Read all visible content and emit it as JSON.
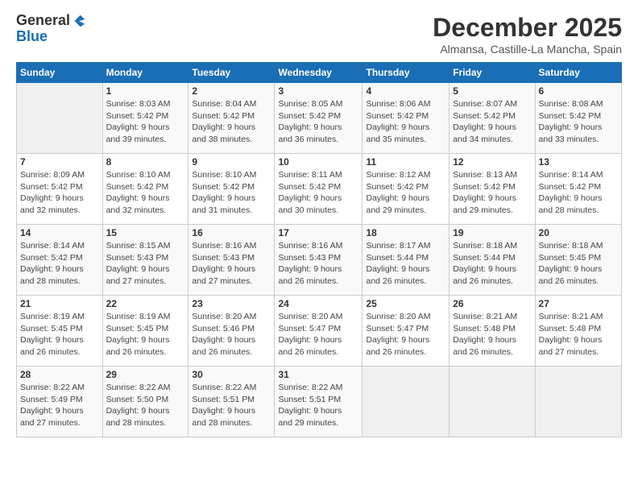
{
  "logo": {
    "line1": "General",
    "line2": "Blue"
  },
  "title": "December 2025",
  "subtitle": "Almansa, Castille-La Mancha, Spain",
  "headers": [
    "Sunday",
    "Monday",
    "Tuesday",
    "Wednesday",
    "Thursday",
    "Friday",
    "Saturday"
  ],
  "weeks": [
    [
      {
        "day": "",
        "info": ""
      },
      {
        "day": "1",
        "info": "Sunrise: 8:03 AM\nSunset: 5:42 PM\nDaylight: 9 hours\nand 39 minutes."
      },
      {
        "day": "2",
        "info": "Sunrise: 8:04 AM\nSunset: 5:42 PM\nDaylight: 9 hours\nand 38 minutes."
      },
      {
        "day": "3",
        "info": "Sunrise: 8:05 AM\nSunset: 5:42 PM\nDaylight: 9 hours\nand 36 minutes."
      },
      {
        "day": "4",
        "info": "Sunrise: 8:06 AM\nSunset: 5:42 PM\nDaylight: 9 hours\nand 35 minutes."
      },
      {
        "day": "5",
        "info": "Sunrise: 8:07 AM\nSunset: 5:42 PM\nDaylight: 9 hours\nand 34 minutes."
      },
      {
        "day": "6",
        "info": "Sunrise: 8:08 AM\nSunset: 5:42 PM\nDaylight: 9 hours\nand 33 minutes."
      }
    ],
    [
      {
        "day": "7",
        "info": "Sunrise: 8:09 AM\nSunset: 5:42 PM\nDaylight: 9 hours\nand 32 minutes."
      },
      {
        "day": "8",
        "info": "Sunrise: 8:10 AM\nSunset: 5:42 PM\nDaylight: 9 hours\nand 32 minutes."
      },
      {
        "day": "9",
        "info": "Sunrise: 8:10 AM\nSunset: 5:42 PM\nDaylight: 9 hours\nand 31 minutes."
      },
      {
        "day": "10",
        "info": "Sunrise: 8:11 AM\nSunset: 5:42 PM\nDaylight: 9 hours\nand 30 minutes."
      },
      {
        "day": "11",
        "info": "Sunrise: 8:12 AM\nSunset: 5:42 PM\nDaylight: 9 hours\nand 29 minutes."
      },
      {
        "day": "12",
        "info": "Sunrise: 8:13 AM\nSunset: 5:42 PM\nDaylight: 9 hours\nand 29 minutes."
      },
      {
        "day": "13",
        "info": "Sunrise: 8:14 AM\nSunset: 5:42 PM\nDaylight: 9 hours\nand 28 minutes."
      }
    ],
    [
      {
        "day": "14",
        "info": "Sunrise: 8:14 AM\nSunset: 5:42 PM\nDaylight: 9 hours\nand 28 minutes."
      },
      {
        "day": "15",
        "info": "Sunrise: 8:15 AM\nSunset: 5:43 PM\nDaylight: 9 hours\nand 27 minutes."
      },
      {
        "day": "16",
        "info": "Sunrise: 8:16 AM\nSunset: 5:43 PM\nDaylight: 9 hours\nand 27 minutes."
      },
      {
        "day": "17",
        "info": "Sunrise: 8:16 AM\nSunset: 5:43 PM\nDaylight: 9 hours\nand 26 minutes."
      },
      {
        "day": "18",
        "info": "Sunrise: 8:17 AM\nSunset: 5:44 PM\nDaylight: 9 hours\nand 26 minutes."
      },
      {
        "day": "19",
        "info": "Sunrise: 8:18 AM\nSunset: 5:44 PM\nDaylight: 9 hours\nand 26 minutes."
      },
      {
        "day": "20",
        "info": "Sunrise: 8:18 AM\nSunset: 5:45 PM\nDaylight: 9 hours\nand 26 minutes."
      }
    ],
    [
      {
        "day": "21",
        "info": "Sunrise: 8:19 AM\nSunset: 5:45 PM\nDaylight: 9 hours\nand 26 minutes."
      },
      {
        "day": "22",
        "info": "Sunrise: 8:19 AM\nSunset: 5:45 PM\nDaylight: 9 hours\nand 26 minutes."
      },
      {
        "day": "23",
        "info": "Sunrise: 8:20 AM\nSunset: 5:46 PM\nDaylight: 9 hours\nand 26 minutes."
      },
      {
        "day": "24",
        "info": "Sunrise: 8:20 AM\nSunset: 5:47 PM\nDaylight: 9 hours\nand 26 minutes."
      },
      {
        "day": "25",
        "info": "Sunrise: 8:20 AM\nSunset: 5:47 PM\nDaylight: 9 hours\nand 26 minutes."
      },
      {
        "day": "26",
        "info": "Sunrise: 8:21 AM\nSunset: 5:48 PM\nDaylight: 9 hours\nand 26 minutes."
      },
      {
        "day": "27",
        "info": "Sunrise: 8:21 AM\nSunset: 5:48 PM\nDaylight: 9 hours\nand 27 minutes."
      }
    ],
    [
      {
        "day": "28",
        "info": "Sunrise: 8:22 AM\nSunset: 5:49 PM\nDaylight: 9 hours\nand 27 minutes."
      },
      {
        "day": "29",
        "info": "Sunrise: 8:22 AM\nSunset: 5:50 PM\nDaylight: 9 hours\nand 28 minutes."
      },
      {
        "day": "30",
        "info": "Sunrise: 8:22 AM\nSunset: 5:51 PM\nDaylight: 9 hours\nand 28 minutes."
      },
      {
        "day": "31",
        "info": "Sunrise: 8:22 AM\nSunset: 5:51 PM\nDaylight: 9 hours\nand 29 minutes."
      },
      {
        "day": "",
        "info": ""
      },
      {
        "day": "",
        "info": ""
      },
      {
        "day": "",
        "info": ""
      }
    ]
  ]
}
